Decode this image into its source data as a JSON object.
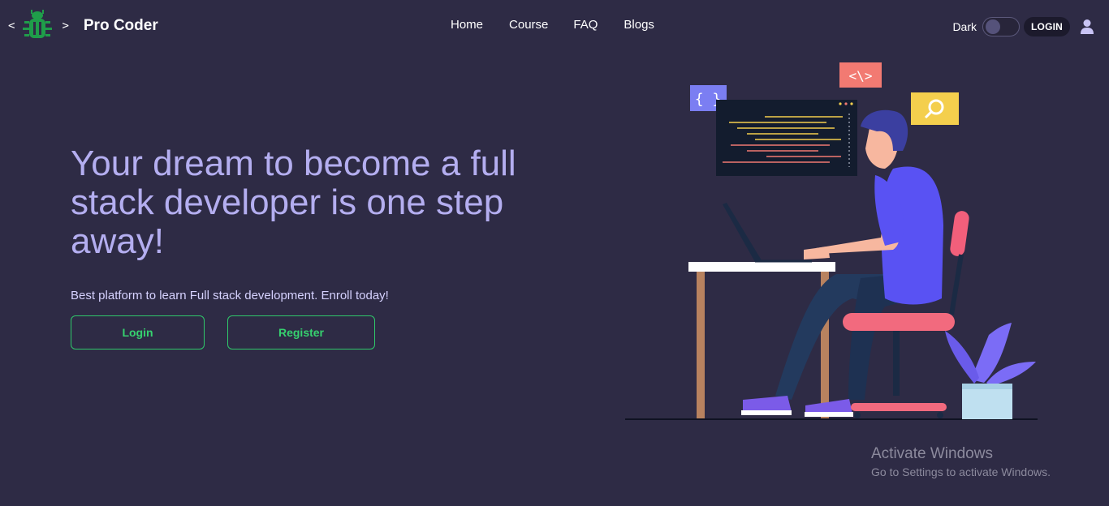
{
  "brand": {
    "lt": "<",
    "gt": ">",
    "name": "Pro Coder",
    "logo_icon": "bug-icon"
  },
  "nav": {
    "links": [
      "Home",
      "Course",
      "FAQ",
      "Blogs"
    ]
  },
  "header_right": {
    "dark_label": "Dark",
    "login_label": "LOGIN",
    "user_icon": "user-icon"
  },
  "hero": {
    "title": "Your dream to become a full stack developer is one step away!",
    "subtitle": "Best platform to learn Full stack development. Enroll today!",
    "login_button": "Login",
    "register_button": "Register"
  },
  "illustration": {
    "brace_badge": "{ }",
    "code_badge": "<\\>",
    "search_icon": "search-icon"
  },
  "watermark": {
    "title": "Activate Windows",
    "subtitle": "Go to Settings to activate Windows."
  },
  "colors": {
    "background": "#2e2b45",
    "accent_purple": "#b4aef0",
    "button_green": "#36d16f"
  }
}
